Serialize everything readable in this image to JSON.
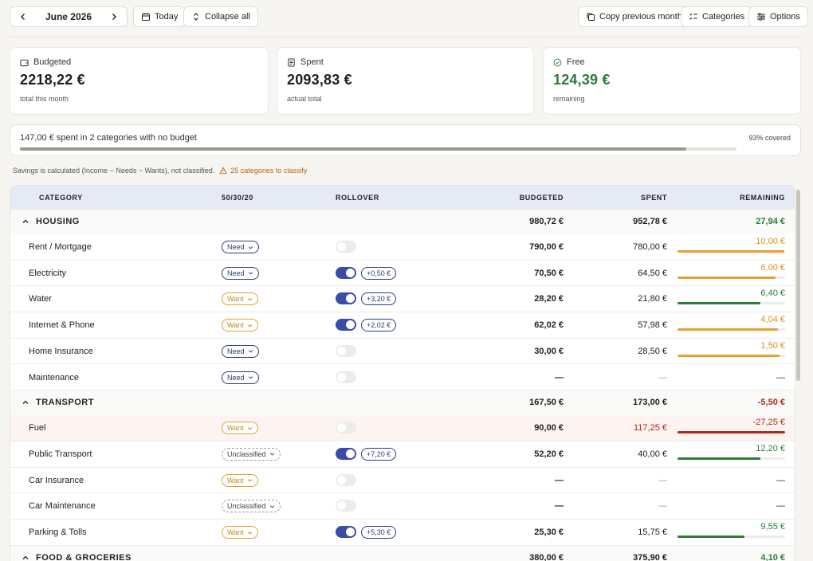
{
  "toolbar": {
    "month": "June 2026",
    "today": "Today",
    "collapse_all": "Collapse all",
    "copy_prev": "Copy previous month",
    "categories": "Categories",
    "options": "Options"
  },
  "cards": {
    "budgeted": {
      "title": "Budgeted",
      "amount": "2218,22 €",
      "sub": "total this month"
    },
    "spent": {
      "title": "Spent",
      "amount": "2093,83 €",
      "sub": "actual total"
    },
    "free": {
      "title": "Free",
      "amount": "124,39 €",
      "sub": "remaining"
    }
  },
  "coverage": {
    "text": "147,00 € spent in 2 categories with no budget",
    "percent_label": "93% covered",
    "percent": 93
  },
  "note": {
    "text": "Savings is calculated (Income − Needs − Wants), not classified.",
    "warn": "25 categories to classify"
  },
  "table": {
    "headers": {
      "category": "CATEGORY",
      "split": "50/30/20",
      "rollover": "ROLLOVER",
      "budgeted": "BUDGETED",
      "spent": "SPENT",
      "remaining": "REMAINING"
    },
    "groups": [
      {
        "name": "HOUSING",
        "budgeted": "980,72 €",
        "spent": "952,78 €",
        "remaining": "27,94 €",
        "tone": "green",
        "rows": [
          {
            "name": "Rent / Mortgage",
            "tag": "Need",
            "rollover": false,
            "roll": "",
            "budgeted": "790,00 €",
            "spent": "780,00 €",
            "remaining": "10,00 €",
            "tone": "orange",
            "fill": 99
          },
          {
            "name": "Electricity",
            "tag": "Need",
            "rollover": true,
            "roll": "+0,50 €",
            "budgeted": "70,50 €",
            "spent": "64,50 €",
            "remaining": "6,00 €",
            "tone": "orange",
            "fill": 91
          },
          {
            "name": "Water",
            "tag": "Want",
            "rollover": true,
            "roll": "+3,20 €",
            "budgeted": "28,20 €",
            "spent": "21,80 €",
            "remaining": "6,40 €",
            "tone": "green",
            "fill": 77
          },
          {
            "name": "Internet & Phone",
            "tag": "Want",
            "rollover": true,
            "roll": "+2,02 €",
            "budgeted": "62,02 €",
            "spent": "57,98 €",
            "remaining": "4,04 €",
            "tone": "orange",
            "fill": 93
          },
          {
            "name": "Home Insurance",
            "tag": "Need",
            "rollover": false,
            "roll": "",
            "budgeted": "30,00 €",
            "spent": "28,50 €",
            "remaining": "1,50 €",
            "tone": "orange",
            "fill": 95
          },
          {
            "name": "Maintenance",
            "tag": "Need",
            "rollover": false,
            "roll": "",
            "budgeted": "—",
            "spent": "—",
            "remaining": "—",
            "tone": "none",
            "fill": 0
          }
        ]
      },
      {
        "name": "TRANSPORT",
        "budgeted": "167,50 €",
        "spent": "173,00 €",
        "remaining": "-5,50 €",
        "tone": "red",
        "rows": [
          {
            "name": "Fuel",
            "tag": "Want",
            "rollover": false,
            "roll": "",
            "budgeted": "90,00 €",
            "spent": "117,25 €",
            "remaining": "-27,25 €",
            "tone": "red",
            "fill": 100,
            "alert": true
          },
          {
            "name": "Public Transport",
            "tag": "Unclassified",
            "rollover": true,
            "roll": "+7,20 €",
            "budgeted": "52,20 €",
            "spent": "40,00 €",
            "remaining": "12,20 €",
            "tone": "green",
            "fill": 77
          },
          {
            "name": "Car Insurance",
            "tag": "Want",
            "rollover": false,
            "roll": "",
            "budgeted": "—",
            "spent": "—",
            "remaining": "—",
            "tone": "none",
            "fill": 0
          },
          {
            "name": "Car Maintenance",
            "tag": "Unclassified",
            "rollover": false,
            "roll": "",
            "budgeted": "—",
            "spent": "—",
            "remaining": "—",
            "tone": "none",
            "fill": 0
          },
          {
            "name": "Parking & Tolls",
            "tag": "Want",
            "rollover": true,
            "roll": "+5,30 €",
            "budgeted": "25,30 €",
            "spent": "15,75 €",
            "remaining": "9,55 €",
            "tone": "green",
            "fill": 62
          }
        ]
      },
      {
        "name": "FOOD & GROCERIES",
        "budgeted": "380,00 €",
        "spent": "375,90 €",
        "remaining": "4,10 €",
        "tone": "green",
        "rows": []
      }
    ]
  }
}
